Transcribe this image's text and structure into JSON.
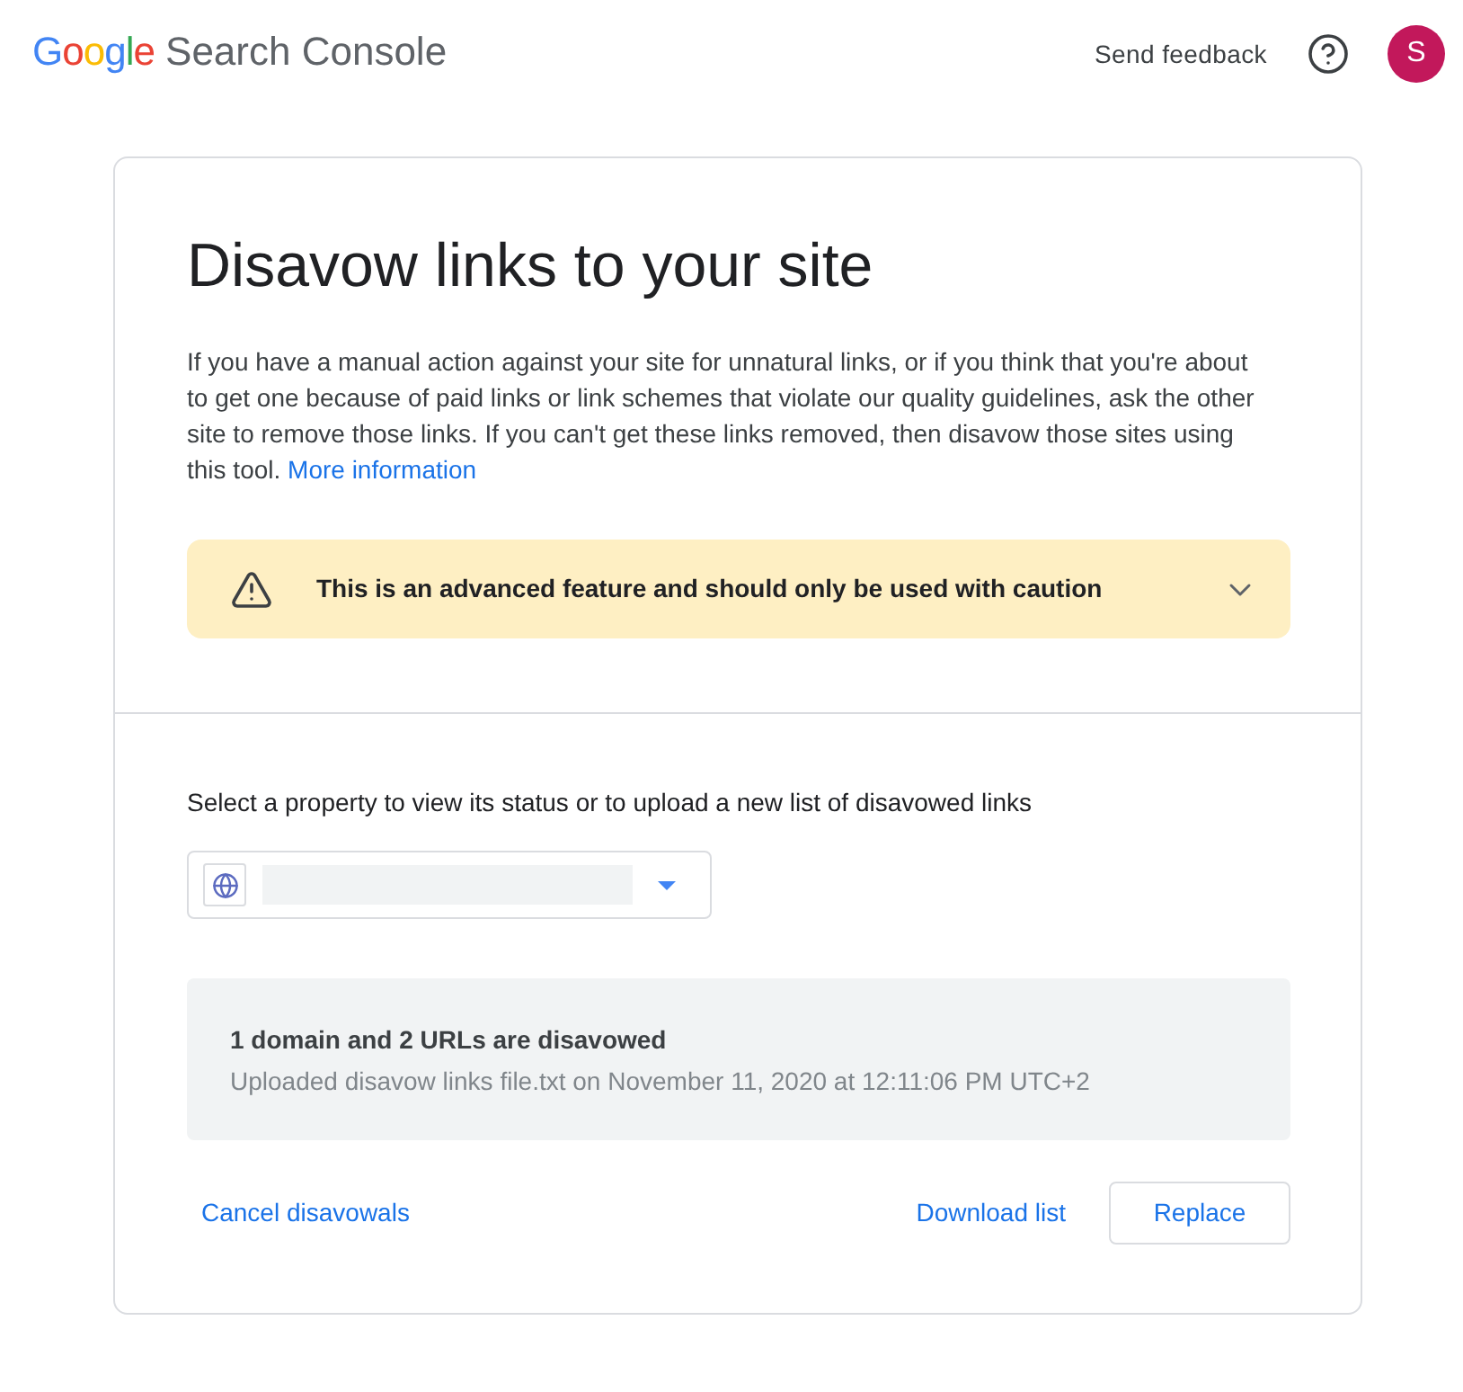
{
  "header": {
    "logo": {
      "brand": "Google",
      "product": "Search Console"
    },
    "send_feedback": "Send feedback",
    "avatar": "S"
  },
  "intro": {
    "title": "Disavow links to your site",
    "description": "If you have a manual action against your site for unnatural links, or if you think that you're about to get one because of paid links or link schemes that violate our quality guidelines, ask the other site to remove those links. If you can't get these links removed, then disavow those sites using this tool.",
    "more_link": "More information"
  },
  "warning": {
    "text": "This is an advanced feature and should only be used with caution",
    "expanded": false
  },
  "property_select": {
    "label": "Select a property to view its status or to upload a new list of disavowed links"
  },
  "status": {
    "summary": "1 domain and 2 URLs are disavowed",
    "detail": "Uploaded disavow links file.txt on November 11, 2020 at 12:11:06 PM UTC+2"
  },
  "left_actions": [
    {
      "kind": "text",
      "label": "Cancel disavowals"
    }
  ],
  "right_actions": [
    {
      "kind": "text",
      "label": "Download list"
    },
    {
      "kind": "outlined",
      "label": "Replace"
    }
  ]
}
